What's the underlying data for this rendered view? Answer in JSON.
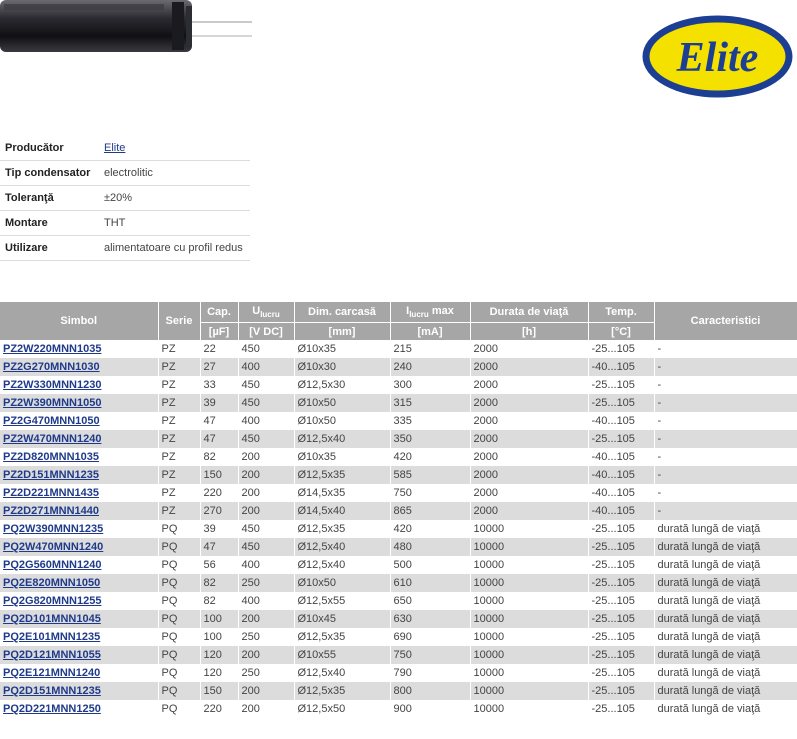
{
  "brand": {
    "logo_text": "Elite"
  },
  "info": [
    {
      "key": "Producător",
      "value": "Elite",
      "link": true
    },
    {
      "key": "Tip condensator",
      "value": "electrolitic",
      "link": false
    },
    {
      "key": "Toleranţă",
      "value": "±20%",
      "link": false
    },
    {
      "key": "Montare",
      "value": "THT",
      "link": false
    },
    {
      "key": "Utilizare",
      "value": "alimentatoare cu profil redus",
      "link": false
    }
  ],
  "table": {
    "headers": {
      "symbol": "Simbol",
      "series": "Serie",
      "cap": "Cap.",
      "voltage_main": "U",
      "voltage_sub": "lucru",
      "dim": "Dim. carcasă",
      "current_main": "I",
      "current_sub": "lucru",
      "current_suffix": " max",
      "life": "Durata de viaţă",
      "temp": "Temp.",
      "features": "Caracteristici"
    },
    "units": {
      "cap": "[µF]",
      "voltage": "[V DC]",
      "dim": "[mm]",
      "current": "[mA]",
      "life": "[h]",
      "temp": "[°C]"
    },
    "rows": [
      [
        "PZ2W220MNN1035",
        "PZ",
        "22",
        "450",
        "Ø10x35",
        "215",
        "2000",
        "-25...105",
        "-"
      ],
      [
        "PZ2G270MNN1030",
        "PZ",
        "27",
        "400",
        "Ø10x30",
        "240",
        "2000",
        "-40...105",
        "-"
      ],
      [
        "PZ2W330MNN1230",
        "PZ",
        "33",
        "450",
        "Ø12,5x30",
        "300",
        "2000",
        "-25...105",
        "-"
      ],
      [
        "PZ2W390MNN1050",
        "PZ",
        "39",
        "450",
        "Ø10x50",
        "315",
        "2000",
        "-25...105",
        "-"
      ],
      [
        "PZ2G470MNN1050",
        "PZ",
        "47",
        "400",
        "Ø10x50",
        "335",
        "2000",
        "-40...105",
        "-"
      ],
      [
        "PZ2W470MNN1240",
        "PZ",
        "47",
        "450",
        "Ø12,5x40",
        "350",
        "2000",
        "-25...105",
        "-"
      ],
      [
        "PZ2D820MNN1035",
        "PZ",
        "82",
        "200",
        "Ø10x35",
        "420",
        "2000",
        "-40...105",
        "-"
      ],
      [
        "PZ2D151MNN1235",
        "PZ",
        "150",
        "200",
        "Ø12,5x35",
        "585",
        "2000",
        "-40...105",
        "-"
      ],
      [
        "PZ2D221MNN1435",
        "PZ",
        "220",
        "200",
        "Ø14,5x35",
        "750",
        "2000",
        "-40...105",
        "-"
      ],
      [
        "PZ2D271MNN1440",
        "PZ",
        "270",
        "200",
        "Ø14,5x40",
        "865",
        "2000",
        "-40...105",
        "-"
      ],
      [
        "PQ2W390MNN1235",
        "PQ",
        "39",
        "450",
        "Ø12,5x35",
        "420",
        "10000",
        "-25...105",
        "durată lungă de viaţă"
      ],
      [
        "PQ2W470MNN1240",
        "PQ",
        "47",
        "450",
        "Ø12,5x40",
        "480",
        "10000",
        "-25...105",
        "durată lungă de viaţă"
      ],
      [
        "PQ2G560MNN1240",
        "PQ",
        "56",
        "400",
        "Ø12,5x40",
        "500",
        "10000",
        "-25...105",
        "durată lungă de viaţă"
      ],
      [
        "PQ2E820MNN1050",
        "PQ",
        "82",
        "250",
        "Ø10x50",
        "610",
        "10000",
        "-25...105",
        "durată lungă de viaţă"
      ],
      [
        "PQ2G820MNN1255",
        "PQ",
        "82",
        "400",
        "Ø12,5x55",
        "650",
        "10000",
        "-25...105",
        "durată lungă de viaţă"
      ],
      [
        "PQ2D101MNN1045",
        "PQ",
        "100",
        "200",
        "Ø10x45",
        "630",
        "10000",
        "-25...105",
        "durată lungă de viaţă"
      ],
      [
        "PQ2E101MNN1235",
        "PQ",
        "100",
        "250",
        "Ø12,5x35",
        "690",
        "10000",
        "-25...105",
        "durată lungă de viaţă"
      ],
      [
        "PQ2D121MNN1055",
        "PQ",
        "120",
        "200",
        "Ø10x55",
        "750",
        "10000",
        "-25...105",
        "durată lungă de viaţă"
      ],
      [
        "PQ2E121MNN1240",
        "PQ",
        "120",
        "250",
        "Ø12,5x40",
        "790",
        "10000",
        "-25...105",
        "durată lungă de viaţă"
      ],
      [
        "PQ2D151MNN1235",
        "PQ",
        "150",
        "200",
        "Ø12,5x35",
        "800",
        "10000",
        "-25...105",
        "durată lungă de viaţă"
      ],
      [
        "PQ2D221MNN1250",
        "PQ",
        "220",
        "200",
        "Ø12,5x50",
        "900",
        "10000",
        "-25...105",
        "durată lungă de viaţă"
      ]
    ]
  }
}
